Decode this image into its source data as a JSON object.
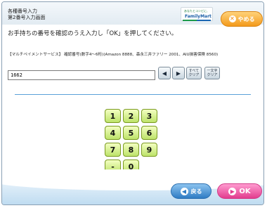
{
  "header": {
    "title_line1": "各種番号入力",
    "title_line2": "第2番号入力画面",
    "logo_top": "あなたとコンビに、",
    "logo_main": "FamilyMart",
    "cancel_label": "やめる"
  },
  "instruction": "お手持ちの番号を確認のうえ入力し「OK」を押してください。",
  "service_text": "【マルチペイメントサービス】 確認番号(数字4〜6桁)(Amazon 8888、森永三井ファリー 2001、AIU損害保険 8560)",
  "input": {
    "value": "1662"
  },
  "controls": {
    "left_arrow": "◀",
    "right_arrow": "▶",
    "clear_all_line1": "すべて",
    "clear_all_line2": "クリア",
    "clear_one_line1": "一文字",
    "clear_one_line2": "クリア"
  },
  "keypad": [
    [
      "1",
      "2",
      "3"
    ],
    [
      "4",
      "5",
      "6"
    ],
    [
      "7",
      "8",
      "9"
    ],
    [
      "-",
      "0"
    ]
  ],
  "footer": {
    "back_label": "戻る",
    "ok_label": "OK"
  },
  "colors": {
    "keypad": "#bde36a",
    "cancel": "#f39a1c",
    "back": "#2f7cc4",
    "ok": "#e23c8e",
    "divider": "#5aa0d8"
  }
}
